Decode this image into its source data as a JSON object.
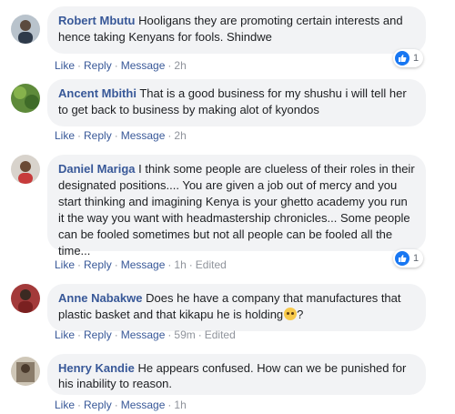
{
  "actions": {
    "like": "Like",
    "reply": "Reply",
    "message": "Message",
    "separator": "·",
    "edited": "Edited"
  },
  "comments": [
    {
      "author": "Robert Mbutu",
      "text": "Hooligans they are promoting certain interests and hence taking Kenyans for fools. Shindwe",
      "time": "2h",
      "edited": false,
      "reactions": "1"
    },
    {
      "author": "Ancent Mbithi",
      "text": "That is a good business for my shushu i will tell her to get back to business by making alot of kyondos",
      "time": "2h",
      "edited": false,
      "reactions": ""
    },
    {
      "author": "Daniel Mariga",
      "text": "I think some people are clueless of their roles in their designated positions.... You are given a job out of mercy and you start thinking and imagining Kenya is your ghetto academy you run it the way you want with headmastership chronicles... Some people can be fooled sometimes but not all people can be fooled all the time...",
      "time": "1h",
      "edited": true,
      "reactions": "1"
    },
    {
      "author": "Anne Nabakwe",
      "text": "Does he have a company that manufactures that plastic basket and that kikapu he is holding",
      "emoji": "grimacing-face-emoji",
      "text_after": "?",
      "time": "59m",
      "edited": true,
      "reactions": ""
    },
    {
      "author": "Henry Kandie",
      "text": "He appears confused. How can we be punished for his inability to reason.",
      "time": "1h",
      "edited": false,
      "reactions": ""
    }
  ],
  "colors": {
    "link": "#385898",
    "bubble": "#f2f3f5",
    "like_blue": "#1877f2",
    "meta": "#90949c"
  }
}
